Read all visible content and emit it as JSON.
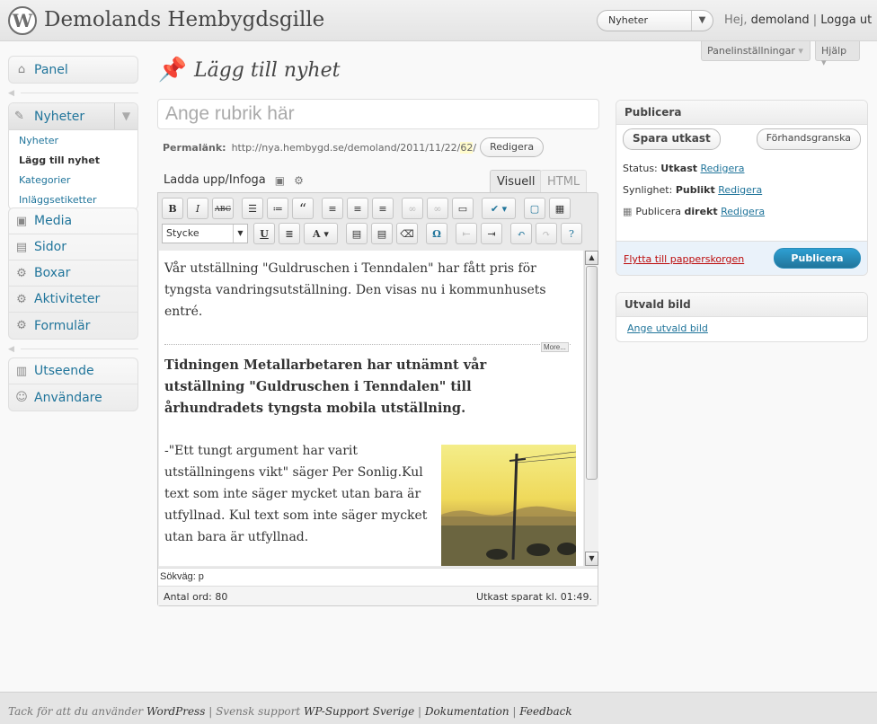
{
  "header": {
    "site_title": "Demolands Hembygdsgille",
    "favorite_select": "Nyheter",
    "greeting": "Hej,",
    "username": "demoland",
    "logout": "Logga ut"
  },
  "screen_meta": {
    "options": "Panelinställningar",
    "help": "Hjälp"
  },
  "sidebar": {
    "dashboard": "Panel",
    "news": "Nyheter",
    "news_sub": [
      "Nyheter",
      "Lägg till nyhet",
      "Kategorier",
      "Inläggsetiketter"
    ],
    "items": [
      "Media",
      "Sidor",
      "Boxar",
      "Aktiviteter",
      "Formulär"
    ],
    "items2": [
      "Utseende",
      "Användare"
    ]
  },
  "page": {
    "heading": "Lägg till nyhet",
    "title_placeholder": "Ange rubrik här",
    "permalink_label": "Permalänk:",
    "permalink_url": "http://nya.hembygd.se/demoland/2011/11/22/",
    "permalink_slug": "62",
    "permalink_end": "/",
    "permalink_edit": "Redigera",
    "media_label": "Ladda upp/Infoga",
    "tab_visual": "Visuell",
    "tab_html": "HTML"
  },
  "editor": {
    "format_select": "Stycke",
    "paragraph1": "Vår utställning \"Guldruschen i Tenndalen\" har fått pris för tyngsta vandringsutställning. Den visas nu i kommunhusets entré.",
    "more_tag": "More...",
    "bold_paragraph": "Tidningen Metallarbetaren har utnämnt vår utställning \"Guldruschen i Tenndalen\" till århundradets tyngsta mobila utställning.",
    "paragraph3": "-\"Ett tungt argument har varit utställningens vikt\" säger Per Sonlig.Kul text som inte säger mycket utan bara är utfyllnad. Kul text som inte säger mycket utan bara är utfyllnad.",
    "path": "Sökväg: p",
    "word_count": "Antal ord: 80",
    "draft_saved": "Utkast sparat kl. 01:49."
  },
  "publish": {
    "title": "Publicera",
    "save_draft": "Spara utkast",
    "preview": "Förhandsgranska",
    "status_label": "Status:",
    "status_value": "Utkast",
    "visibility_label": "Synlighet:",
    "visibility_value": "Publikt",
    "publish_label": "Publicera",
    "publish_value": "direkt",
    "edit": "Redigera",
    "trash": "Flytta till papperskorgen",
    "publish_button": "Publicera"
  },
  "featured": {
    "title": "Utvald bild",
    "link": "Ange utvald bild"
  },
  "footer": {
    "thanks": "Tack för att du använder",
    "wordpress": "WordPress",
    "support_label": "Svensk support",
    "support_link": "WP-Support Sverige",
    "docs": "Dokumentation",
    "feedback": "Feedback"
  }
}
